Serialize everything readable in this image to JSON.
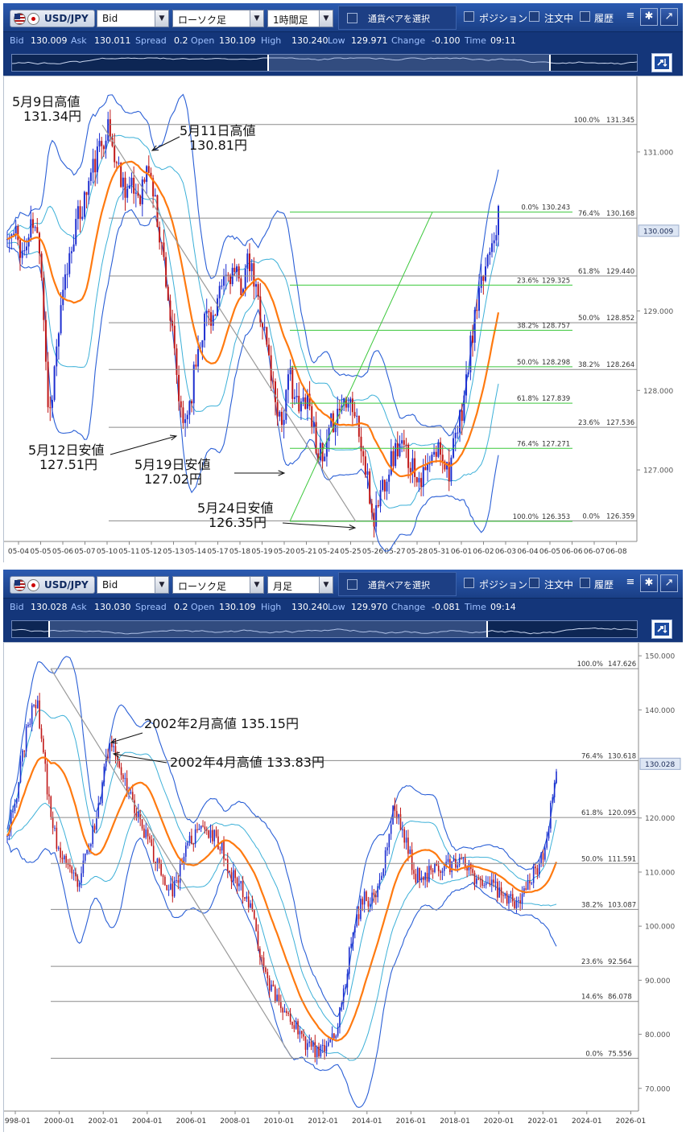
{
  "colors": {
    "toolbar": "#1f4996",
    "candle_up": "#1e2fd0",
    "candle_down": "#c01818",
    "ma": "#ff7a10",
    "band_outer": "#2a5fd6",
    "band_inner": "#3cb0d8",
    "fib_gray": "#8a8a8a",
    "fib_green": "#3cc83c",
    "trend_gray": "#9a9a9a"
  },
  "icons": [
    "us-flag-icon",
    "jp-flag-icon",
    "list-icon",
    "gear-icon",
    "expand-icon",
    "swap-icon"
  ],
  "panels": [
    {
      "pair": "USD/JPY",
      "price_type": "Bid",
      "chart_type": "ローソク足",
      "timeframe": "1時間足",
      "pair_select": "通貨ペアを選択",
      "positions": "ポジション",
      "orders": "注文中",
      "history": "履歴",
      "stats": [
        {
          "k": "Bid",
          "v": "130.009"
        },
        {
          "k": "Ask",
          "v": "130.011"
        },
        {
          "k": "Spread",
          "v": "0.2"
        },
        {
          "k": "Open",
          "v": "130.109"
        },
        {
          "k": "High",
          "v": "130.240"
        },
        {
          "k": "Low",
          "v": "129.971"
        },
        {
          "k": "Change",
          "v": "-0.100"
        },
        {
          "k": "Time",
          "v": "09:11"
        }
      ]
    },
    {
      "pair": "USD/JPY",
      "price_type": "Bid",
      "chart_type": "ローソク足",
      "timeframe": "月足",
      "pair_select": "通貨ペアを選択",
      "positions": "ポジション",
      "orders": "注文中",
      "history": "履歴",
      "stats": [
        {
          "k": "Bid",
          "v": "130.028"
        },
        {
          "k": "Ask",
          "v": "130.030"
        },
        {
          "k": "Spread",
          "v": "0.2"
        },
        {
          "k": "Open",
          "v": "130.109"
        },
        {
          "k": "High",
          "v": "130.240"
        },
        {
          "k": "Low",
          "v": "129.970"
        },
        {
          "k": "Change",
          "v": "-0.081"
        },
        {
          "k": "Time",
          "v": "09:14"
        }
      ]
    }
  ],
  "chart_data": [
    {
      "type": "candlestick",
      "x_ticks": [
        "05-04",
        "05-05",
        "05-06",
        "05-07",
        "05-10",
        "05-11",
        "05-12",
        "05-13",
        "05-14",
        "05-17",
        "05-18",
        "05-19",
        "05-20",
        "05-21",
        "05-24",
        "05-25",
        "05-26",
        "05-27",
        "05-28",
        "05-31",
        "06-01",
        "06-02",
        "06-03",
        "06-04",
        "06-05",
        "06-06",
        "06-07",
        "06-08"
      ],
      "y_ticks": [
        "131.000",
        "130.009",
        "129.000",
        "128.000",
        "127.000"
      ],
      "ylim": [
        126.1,
        131.95
      ],
      "current_price": "130.009",
      "close_series": [
        129.9,
        129.95,
        129.7,
        130.1,
        129.8,
        127.6,
        128.6,
        129.4,
        130.0,
        130.3,
        130.7,
        131.0,
        131.34,
        130.9,
        130.6,
        130.5,
        130.5,
        130.81,
        130.2,
        129.5,
        128.5,
        127.51,
        127.9,
        128.6,
        129.0,
        128.9,
        129.4,
        129.5,
        129.3,
        129.6,
        129.2,
        128.7,
        128.0,
        127.6,
        128.2,
        127.7,
        128.0,
        127.4,
        127.02,
        127.6,
        127.8,
        128.0,
        127.6,
        127.0,
        126.35,
        126.8,
        127.1,
        127.3,
        127.2,
        127.0,
        126.9,
        127.1,
        127.3,
        127.0,
        127.4,
        128.0,
        128.8,
        129.3,
        129.9,
        130.168
      ],
      "fib_gray": [
        {
          "left": "100.0%",
          "right": "131.345"
        },
        {
          "left": "76.4%",
          "right": "130.168"
        },
        {
          "left": "61.8%",
          "right": "129.440"
        },
        {
          "left": "50.0%",
          "right": "128.852"
        },
        {
          "left": "38.2%",
          "right": "128.264"
        },
        {
          "left": "23.6%",
          "right": "127.536"
        },
        {
          "left": "0.0%",
          "right": "126.359"
        }
      ],
      "fib_green": [
        {
          "left": "0.0%",
          "right": "130.243"
        },
        {
          "left": "23.6%",
          "right": "129.325"
        },
        {
          "left": "38.2%",
          "right": "128.757"
        },
        {
          "left": "50.0%",
          "right": "128.298"
        },
        {
          "left": "61.8%",
          "right": "127.839"
        },
        {
          "left": "76.4%",
          "right": "127.271"
        },
        {
          "left": "100.0%",
          "right": "126.353"
        }
      ],
      "annotations": [
        {
          "line1": "5月9日高値",
          "line2": "131.34円"
        },
        {
          "line1": "5月11日高値",
          "line2": "130.81円"
        },
        {
          "line1": "5月12日安値",
          "line2": "127.51円"
        },
        {
          "line1": "5月19日安値",
          "line2": "127.02円"
        },
        {
          "line1": "5月24日安値",
          "line2": "126.35円"
        }
      ]
    },
    {
      "type": "candlestick",
      "x_ticks": [
        "1998-01",
        "2000-01",
        "2002-01",
        "2004-01",
        "2006-01",
        "2008-01",
        "2010-01",
        "2012-01",
        "2014-01",
        "2016-01",
        "2018-01",
        "2020-01",
        "2022-01",
        "2024-01",
        "2026-01"
      ],
      "y_ticks": [
        "150.000",
        "140.000",
        "130.028",
        "120.000",
        "110.000",
        "100.000",
        "90.000",
        "80.000",
        "70.000"
      ],
      "ylim": [
        65.8,
        152.4
      ],
      "current_price": "130.028",
      "close_series": [
        118,
        125,
        138,
        141,
        124,
        114,
        110,
        108,
        114,
        122,
        133.8,
        131,
        124,
        120,
        115,
        111,
        106,
        110,
        116,
        118,
        117,
        115,
        110,
        107,
        104,
        94,
        88,
        85,
        83,
        79,
        77,
        77,
        79,
        86,
        100,
        105,
        105,
        111,
        122,
        117,
        110,
        108,
        112,
        111,
        111,
        112,
        109,
        108,
        107,
        106,
        104,
        108,
        110,
        115,
        130
      ],
      "fib_gray": [
        {
          "left": "100.0%",
          "right": "147.626"
        },
        {
          "left": "76.4%",
          "right": "130.618"
        },
        {
          "left": "61.8%",
          "right": "120.095"
        },
        {
          "left": "50.0%",
          "right": "111.591"
        },
        {
          "left": "38.2%",
          "right": "103.087"
        },
        {
          "left": "23.6%",
          "right": "92.564"
        },
        {
          "left": "14.6%",
          "right": "86.078"
        },
        {
          "left": "0.0%",
          "right": "75.556"
        }
      ],
      "annotations": [
        {
          "text": "2002年2月高値 135.15円"
        },
        {
          "text": "2002年4月高値 133.83円"
        }
      ]
    }
  ]
}
